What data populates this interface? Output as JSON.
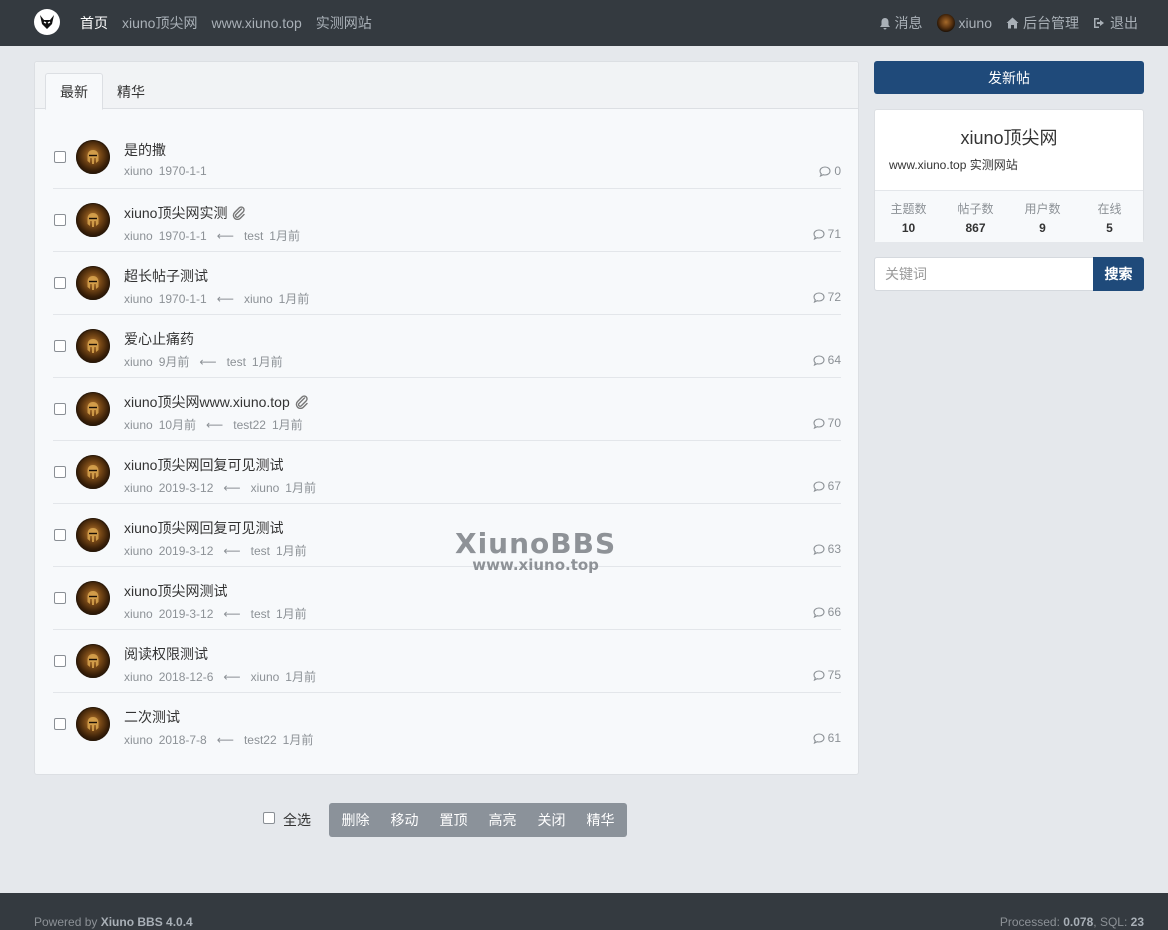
{
  "header": {
    "nav": [
      "首页",
      "xiuno顶尖网",
      "www.xiuno.top",
      "实测网站"
    ],
    "right": {
      "messages": "消息",
      "user": "xiuno",
      "admin": "后台管理",
      "logout": "退出"
    }
  },
  "tabs": [
    "最新",
    "精华"
  ],
  "threads": [
    {
      "title": "是的撒",
      "author": "xiuno",
      "date": "1970-1-1",
      "last_user": "",
      "last_time": "",
      "replies": "0",
      "attachment": false
    },
    {
      "title": "xiuno顶尖网实测",
      "author": "xiuno",
      "date": "1970-1-1",
      "last_user": "test",
      "last_time": "1月前",
      "replies": "71",
      "attachment": true
    },
    {
      "title": "超长帖子测试",
      "author": "xiuno",
      "date": "1970-1-1",
      "last_user": "xiuno",
      "last_time": "1月前",
      "replies": "72",
      "attachment": false
    },
    {
      "title": "爱心止痛药",
      "author": "xiuno",
      "date": "9月前",
      "last_user": "test",
      "last_time": "1月前",
      "replies": "64",
      "attachment": false
    },
    {
      "title": "xiuno顶尖网www.xiuno.top",
      "author": "xiuno",
      "date": "10月前",
      "last_user": "test22",
      "last_time": "1月前",
      "replies": "70",
      "attachment": true
    },
    {
      "title": "xiuno顶尖网回复可见测试",
      "author": "xiuno",
      "date": "2019-3-12",
      "last_user": "xiuno",
      "last_time": "1月前",
      "replies": "67",
      "attachment": false
    },
    {
      "title": "xiuno顶尖网回复可见测试",
      "author": "xiuno",
      "date": "2019-3-12",
      "last_user": "test",
      "last_time": "1月前",
      "replies": "63",
      "attachment": false
    },
    {
      "title": "xiuno顶尖网测试",
      "author": "xiuno",
      "date": "2019-3-12",
      "last_user": "test",
      "last_time": "1月前",
      "replies": "66",
      "attachment": false
    },
    {
      "title": "阅读权限测试",
      "author": "xiuno",
      "date": "2018-12-6",
      "last_user": "xiuno",
      "last_time": "1月前",
      "replies": "75",
      "attachment": false
    },
    {
      "title": "二次测试",
      "author": "xiuno",
      "date": "2018-7-8",
      "last_user": "test22",
      "last_time": "1月前",
      "replies": "61",
      "attachment": false
    }
  ],
  "watermark": {
    "big": "XiunoBBS",
    "small": "www.xiuno.top"
  },
  "sidebar": {
    "post_button": "发新帖",
    "site_name": "xiuno顶尖网",
    "site_desc": "www.xiuno.top 实测网站",
    "stats": [
      {
        "label": "主题数",
        "value": "10"
      },
      {
        "label": "帖子数",
        "value": "867"
      },
      {
        "label": "用户数",
        "value": "9"
      },
      {
        "label": "在线",
        "value": "5"
      }
    ],
    "search_placeholder": "关键词",
    "search_button": "搜索"
  },
  "bottom": {
    "select_all": "全选",
    "actions": [
      "删除",
      "移动",
      "置顶",
      "高亮",
      "关闭",
      "精华"
    ]
  },
  "footer": {
    "powered_prefix": "Powered by ",
    "powered_name": "Xiuno BBS 4.0.4",
    "processed_label": "Processed: ",
    "processed_value": "0.078",
    "sql_label": ", SQL: ",
    "sql_value": "23"
  },
  "colors": {
    "navbar": "#343a40",
    "primary": "#1f4a7a",
    "action_bar": "#8b929a"
  }
}
